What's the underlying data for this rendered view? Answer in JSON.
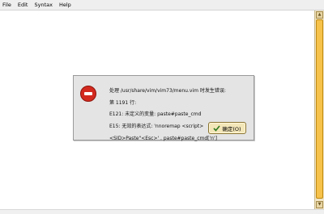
{
  "menubar": {
    "items": [
      {
        "label": "File"
      },
      {
        "label": "Edit"
      },
      {
        "label": "Syntax"
      },
      {
        "label": "Help"
      }
    ]
  },
  "dialog": {
    "icon": "error-icon",
    "message_lines": [
      "处理 /usr/share/vim/vim73/menu.vim 时发生错误:",
      "第 1191 行:",
      "E121: 未定义的变量: paste#paste_cmd",
      "E15: 无效的表达式: 'nnoremap <script>",
      "<SID>Paste\"<Esc>' . paste#paste_cmd['n']"
    ],
    "ok_label": "确定(O)"
  },
  "colors": {
    "error": "#d32a1f",
    "scroll_thumb": "#f6c24a",
    "dialog_bg": "#e4e4e4"
  }
}
